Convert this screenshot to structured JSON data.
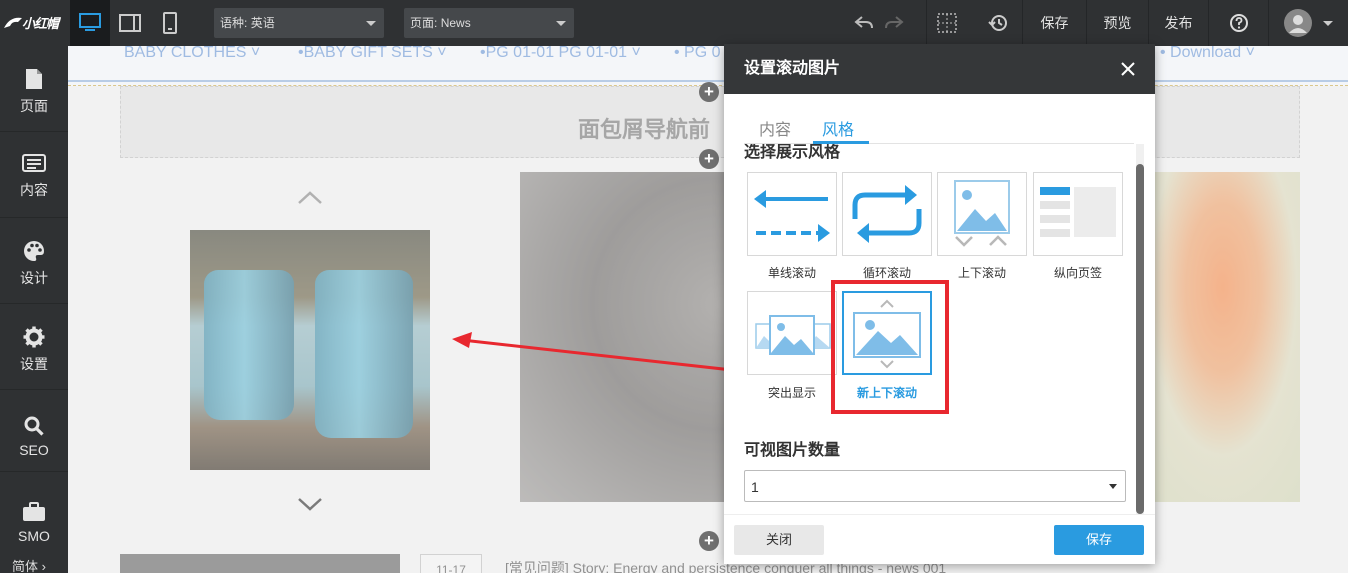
{
  "topbar": {
    "logo": "小红帽",
    "language_label": "语种:",
    "language_value": "英语",
    "page_label": "页面:",
    "page_value": "News",
    "save": "保存",
    "preview": "预览",
    "publish": "发布"
  },
  "sidebar": {
    "items": [
      {
        "label": "页面",
        "icon": "page-icon"
      },
      {
        "label": "内容",
        "icon": "content-icon"
      },
      {
        "label": "设计",
        "icon": "palette-icon"
      },
      {
        "label": "设置",
        "icon": "gear-icon"
      },
      {
        "label": "SEO",
        "icon": "search-icon"
      },
      {
        "label": "SMO",
        "icon": "briefcase-icon"
      }
    ],
    "language": "简体 ›"
  },
  "canvas": {
    "nav_items": [
      "BABY CLOTHES ˅",
      "•BABY GIFT SETS ˅",
      "•PG 01-01 PG 01-01 ˅",
      "• PG 0",
      "• Download ˅"
    ],
    "breadcrumb_title": "面包屑导航前",
    "news_date": "11-17",
    "news_text": "[常见问题] Story: Energy and persistence conquer all things - news 001"
  },
  "dialog": {
    "title": "设置滚动图片",
    "tabs": [
      {
        "label": "内容",
        "active": false
      },
      {
        "label": "风格",
        "active": true
      }
    ],
    "style_section_title": "选择展示风格",
    "styles": [
      {
        "label": "单线滚动",
        "icon": "single-scroll-icon"
      },
      {
        "label": "循环滚动",
        "icon": "loop-scroll-icon"
      },
      {
        "label": "上下滚动",
        "icon": "vertical-scroll-icon"
      },
      {
        "label": "纵向页签",
        "icon": "vertical-tabs-icon"
      },
      {
        "label": "突出显示",
        "icon": "highlight-display-icon"
      },
      {
        "label": "新上下滚动",
        "icon": "new-vertical-scroll-icon",
        "selected": true
      }
    ],
    "count_section_title": "可视图片数量",
    "count_value": "1",
    "close_button": "关闭",
    "save_button": "保存"
  },
  "colors": {
    "accent": "#2a9be0",
    "highlight_box": "#e8282f",
    "toolbar_bg": "#2f3133"
  }
}
